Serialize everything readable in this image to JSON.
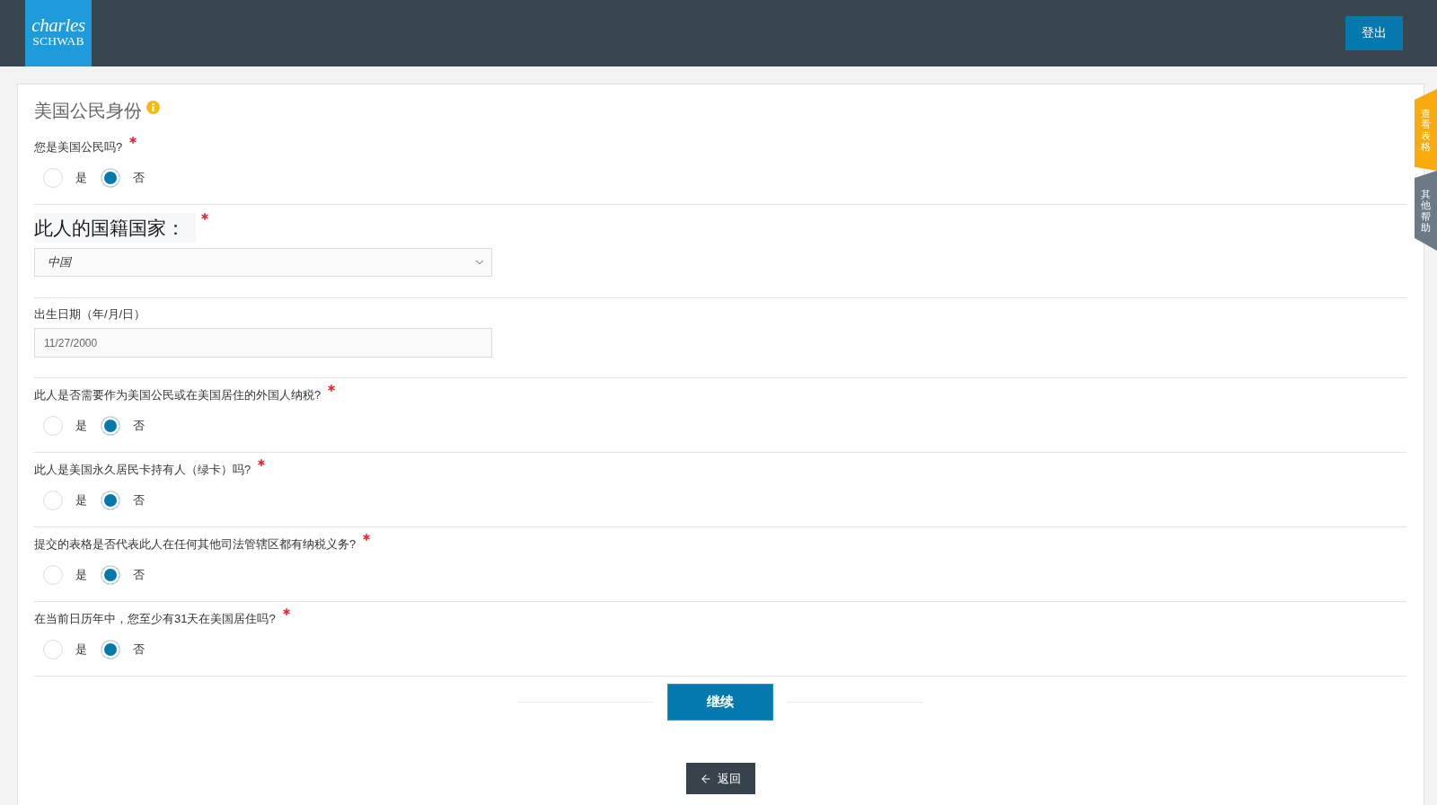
{
  "header": {
    "logo": {
      "line_1": "charles",
      "line_2": "SCHWAB"
    },
    "logout_button": "登出"
  },
  "side_tabs": [
    {
      "label": "查看表格",
      "color": "#f9aa0c"
    },
    {
      "label": "其他帮助",
      "color": "#6b7a86"
    }
  ],
  "form": {
    "title": "美国公民身份",
    "questions": [
      {
        "kind": "radio",
        "label": "您是美国公民吗?",
        "required": true,
        "options": [
          {
            "label": "是",
            "selected": false
          },
          {
            "label": "否",
            "selected": true
          }
        ]
      },
      {
        "kind": "select",
        "label": "此人的国籍国家：",
        "required": true,
        "value": "中国"
      },
      {
        "kind": "date",
        "label": "出生日期（年/月/日）",
        "required": false,
        "value": "11/27/2000"
      },
      {
        "kind": "radio",
        "label": "此人是否需要作为美国公民或在美国居住的外国人纳税?",
        "required": true,
        "options": [
          {
            "label": "是",
            "selected": false
          },
          {
            "label": "否",
            "selected": true
          }
        ]
      },
      {
        "kind": "radio",
        "label": "此人是美国永久居民卡持有人（绿卡）吗?",
        "required": true,
        "options": [
          {
            "label": "是",
            "selected": false
          },
          {
            "label": "否",
            "selected": true
          }
        ]
      },
      {
        "kind": "radio",
        "label": "提交的表格是否代表此人在任何其他司法管辖区都有纳税义务?",
        "required": true,
        "options": [
          {
            "label": "是",
            "selected": false
          },
          {
            "label": "否",
            "selected": true
          }
        ]
      },
      {
        "kind": "radio",
        "label": "在当前日历年中，您至少有31天在美国居住吗?",
        "required": true,
        "options": [
          {
            "label": "是",
            "selected": false
          },
          {
            "label": "否",
            "selected": true
          }
        ]
      }
    ],
    "continue_button": "继续",
    "back_button": "返回"
  }
}
